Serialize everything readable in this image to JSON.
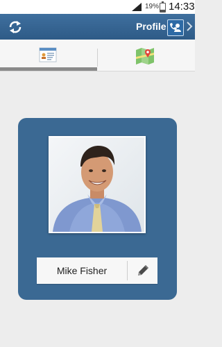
{
  "status_bar": {
    "battery_percent": "19%",
    "time": "14:33"
  },
  "action_bar": {
    "title": "Profile",
    "refresh_icon": "refresh-icon",
    "contact_icon": "contact-phone-icon",
    "chevron_icon": "chevron-right-icon"
  },
  "tabs": [
    {
      "icon": "profile-card-icon",
      "selected": true
    },
    {
      "icon": "map-icon",
      "selected": false
    }
  ],
  "profile": {
    "name": "Mike Fisher",
    "photo_icon": "person-photo",
    "edit_icon": "pencil-icon"
  },
  "colors": {
    "action_bar": "#2e5b87",
    "card": "#3b6993",
    "background": "#ededed",
    "tab_indicator": "#8a8a8a"
  }
}
